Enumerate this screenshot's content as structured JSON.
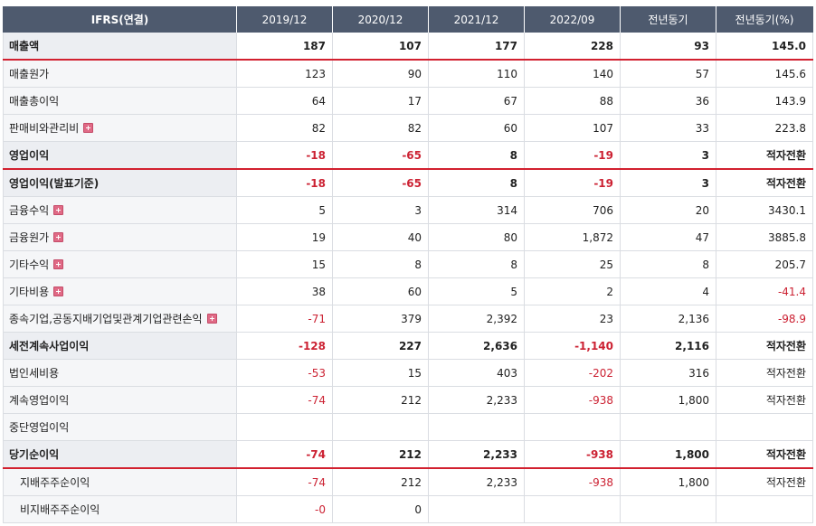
{
  "table": {
    "headers": [
      "IFRS(연결)",
      "2019/12",
      "2020/12",
      "2021/12",
      "2022/09",
      "전년동기",
      "전년동기(%)"
    ],
    "rows": [
      {
        "label": "매출액",
        "values": [
          "187",
          "107",
          "177",
          "228",
          "93",
          "145.0"
        ],
        "negative": [
          false,
          false,
          false,
          false,
          false,
          false
        ],
        "bold": true,
        "redline": true,
        "expand": false,
        "indent": false
      },
      {
        "label": "매출원가",
        "values": [
          "123",
          "90",
          "110",
          "140",
          "57",
          "145.6"
        ],
        "negative": [
          false,
          false,
          false,
          false,
          false,
          false
        ],
        "bold": false,
        "redline": false,
        "expand": false,
        "indent": false
      },
      {
        "label": "매출총이익",
        "values": [
          "64",
          "17",
          "67",
          "88",
          "36",
          "143.9"
        ],
        "negative": [
          false,
          false,
          false,
          false,
          false,
          false
        ],
        "bold": false,
        "redline": false,
        "expand": false,
        "indent": false
      },
      {
        "label": "판매비와관리비",
        "values": [
          "82",
          "82",
          "60",
          "107",
          "33",
          "223.8"
        ],
        "negative": [
          false,
          false,
          false,
          false,
          false,
          false
        ],
        "bold": false,
        "redline": false,
        "expand": true,
        "indent": false
      },
      {
        "label": "영업이익",
        "values": [
          "-18",
          "-65",
          "8",
          "-19",
          "3",
          "적자전환"
        ],
        "negative": [
          true,
          true,
          false,
          true,
          false,
          false
        ],
        "bold": true,
        "redline": true,
        "expand": false,
        "indent": false
      },
      {
        "label": "영업이익(발표기준)",
        "values": [
          "-18",
          "-65",
          "8",
          "-19",
          "3",
          "적자전환"
        ],
        "negative": [
          true,
          true,
          false,
          true,
          false,
          false
        ],
        "bold": true,
        "redline": false,
        "expand": false,
        "indent": false
      },
      {
        "label": "금융수익",
        "values": [
          "5",
          "3",
          "314",
          "706",
          "20",
          "3430.1"
        ],
        "negative": [
          false,
          false,
          false,
          false,
          false,
          false
        ],
        "bold": false,
        "redline": false,
        "expand": true,
        "indent": false
      },
      {
        "label": "금융원가",
        "values": [
          "19",
          "40",
          "80",
          "1,872",
          "47",
          "3885.8"
        ],
        "negative": [
          false,
          false,
          false,
          false,
          false,
          false
        ],
        "bold": false,
        "redline": false,
        "expand": true,
        "indent": false
      },
      {
        "label": "기타수익",
        "values": [
          "15",
          "8",
          "8",
          "25",
          "8",
          "205.7"
        ],
        "negative": [
          false,
          false,
          false,
          false,
          false,
          false
        ],
        "bold": false,
        "redline": false,
        "expand": true,
        "indent": false
      },
      {
        "label": "기타비용",
        "values": [
          "38",
          "60",
          "5",
          "2",
          "4",
          "-41.4"
        ],
        "negative": [
          false,
          false,
          false,
          false,
          false,
          true
        ],
        "bold": false,
        "redline": false,
        "expand": true,
        "indent": false
      },
      {
        "label": "종속기업,공동지배기업및관계기업관련손익",
        "values": [
          "-71",
          "379",
          "2,392",
          "23",
          "2,136",
          "-98.9"
        ],
        "negative": [
          true,
          false,
          false,
          false,
          false,
          true
        ],
        "bold": false,
        "redline": false,
        "expand": true,
        "indent": false
      },
      {
        "label": "세전계속사업이익",
        "values": [
          "-128",
          "227",
          "2,636",
          "-1,140",
          "2,116",
          "적자전환"
        ],
        "negative": [
          true,
          false,
          false,
          true,
          false,
          false
        ],
        "bold": true,
        "redline": false,
        "expand": false,
        "indent": false
      },
      {
        "label": "법인세비용",
        "values": [
          "-53",
          "15",
          "403",
          "-202",
          "316",
          "적자전환"
        ],
        "negative": [
          true,
          false,
          false,
          true,
          false,
          false
        ],
        "bold": false,
        "redline": false,
        "expand": false,
        "indent": false
      },
      {
        "label": "계속영업이익",
        "values": [
          "-74",
          "212",
          "2,233",
          "-938",
          "1,800",
          "적자전환"
        ],
        "negative": [
          true,
          false,
          false,
          true,
          false,
          false
        ],
        "bold": false,
        "redline": false,
        "expand": false,
        "indent": false
      },
      {
        "label": "중단영업이익",
        "values": [
          "",
          "",
          "",
          "",
          "",
          ""
        ],
        "negative": [
          false,
          false,
          false,
          false,
          false,
          false
        ],
        "bold": false,
        "redline": false,
        "expand": false,
        "indent": false
      },
      {
        "label": "당기순이익",
        "values": [
          "-74",
          "212",
          "2,233",
          "-938",
          "1,800",
          "적자전환"
        ],
        "negative": [
          true,
          false,
          false,
          true,
          false,
          false
        ],
        "bold": true,
        "redline": true,
        "expand": false,
        "indent": false
      },
      {
        "label": "지배주주순이익",
        "values": [
          "-74",
          "212",
          "2,233",
          "-938",
          "1,800",
          "적자전환"
        ],
        "negative": [
          true,
          false,
          false,
          true,
          false,
          false
        ],
        "bold": false,
        "redline": false,
        "expand": false,
        "indent": true
      },
      {
        "label": "비지배주주순이익",
        "values": [
          "-0",
          "0",
          "",
          "",
          "",
          ""
        ],
        "negative": [
          true,
          false,
          false,
          false,
          false,
          false
        ],
        "bold": false,
        "redline": false,
        "expand": false,
        "indent": true
      }
    ]
  },
  "icons": {
    "expand": "plus-square-icon"
  },
  "colors": {
    "header_bg": "#4e5a6e",
    "negative": "#cc2233",
    "divider": "#d2202f",
    "expand_icon": "#e06a86"
  }
}
